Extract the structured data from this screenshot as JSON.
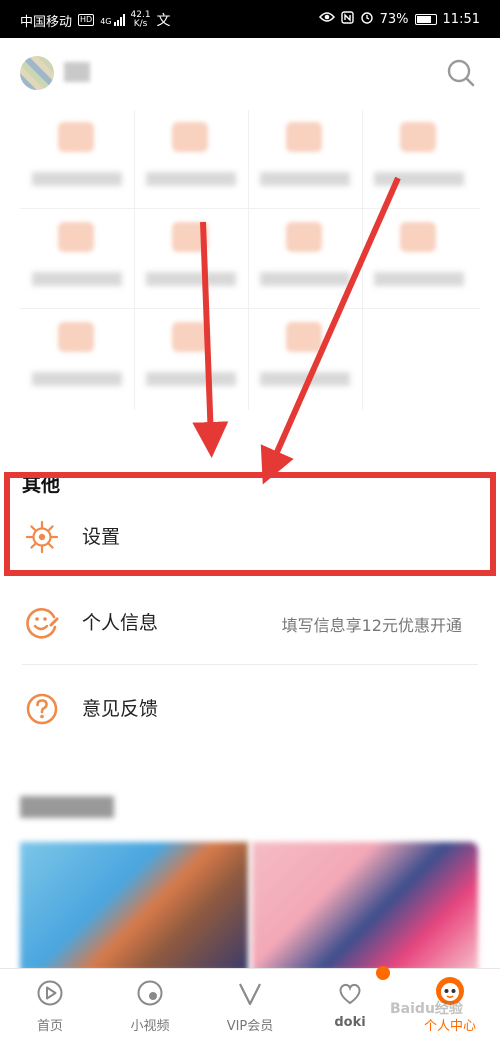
{
  "status_bar": {
    "carrier": "中国移动",
    "hd": "HD",
    "signal": "4G",
    "net_speed_value": "42.1",
    "net_speed_unit": "K/s",
    "battery": "73%",
    "time": "11:51"
  },
  "colors": {
    "accent": "#ff6a00",
    "annotation_red": "#e53935",
    "icon_orange": "#f08a4b"
  },
  "section_other": {
    "title": "其他",
    "items": [
      {
        "label": "设置",
        "icon": "gear-icon",
        "note": ""
      },
      {
        "label": "个人信息",
        "icon": "smile-edit-icon",
        "note": "填写信息享12元优惠开通"
      },
      {
        "label": "意见反馈",
        "icon": "question-icon",
        "note": ""
      }
    ]
  },
  "tab_bar": {
    "items": [
      {
        "label": "首页",
        "icon": "play-circle-icon"
      },
      {
        "label": "小视频",
        "icon": "bubble-icon"
      },
      {
        "label": "VIP会员",
        "icon": "v-icon"
      },
      {
        "label": "doki",
        "icon": "heart-icon"
      },
      {
        "label": "个人中心",
        "icon": "profile-face-icon",
        "active": true
      }
    ]
  },
  "watermark": "Baidu经验"
}
